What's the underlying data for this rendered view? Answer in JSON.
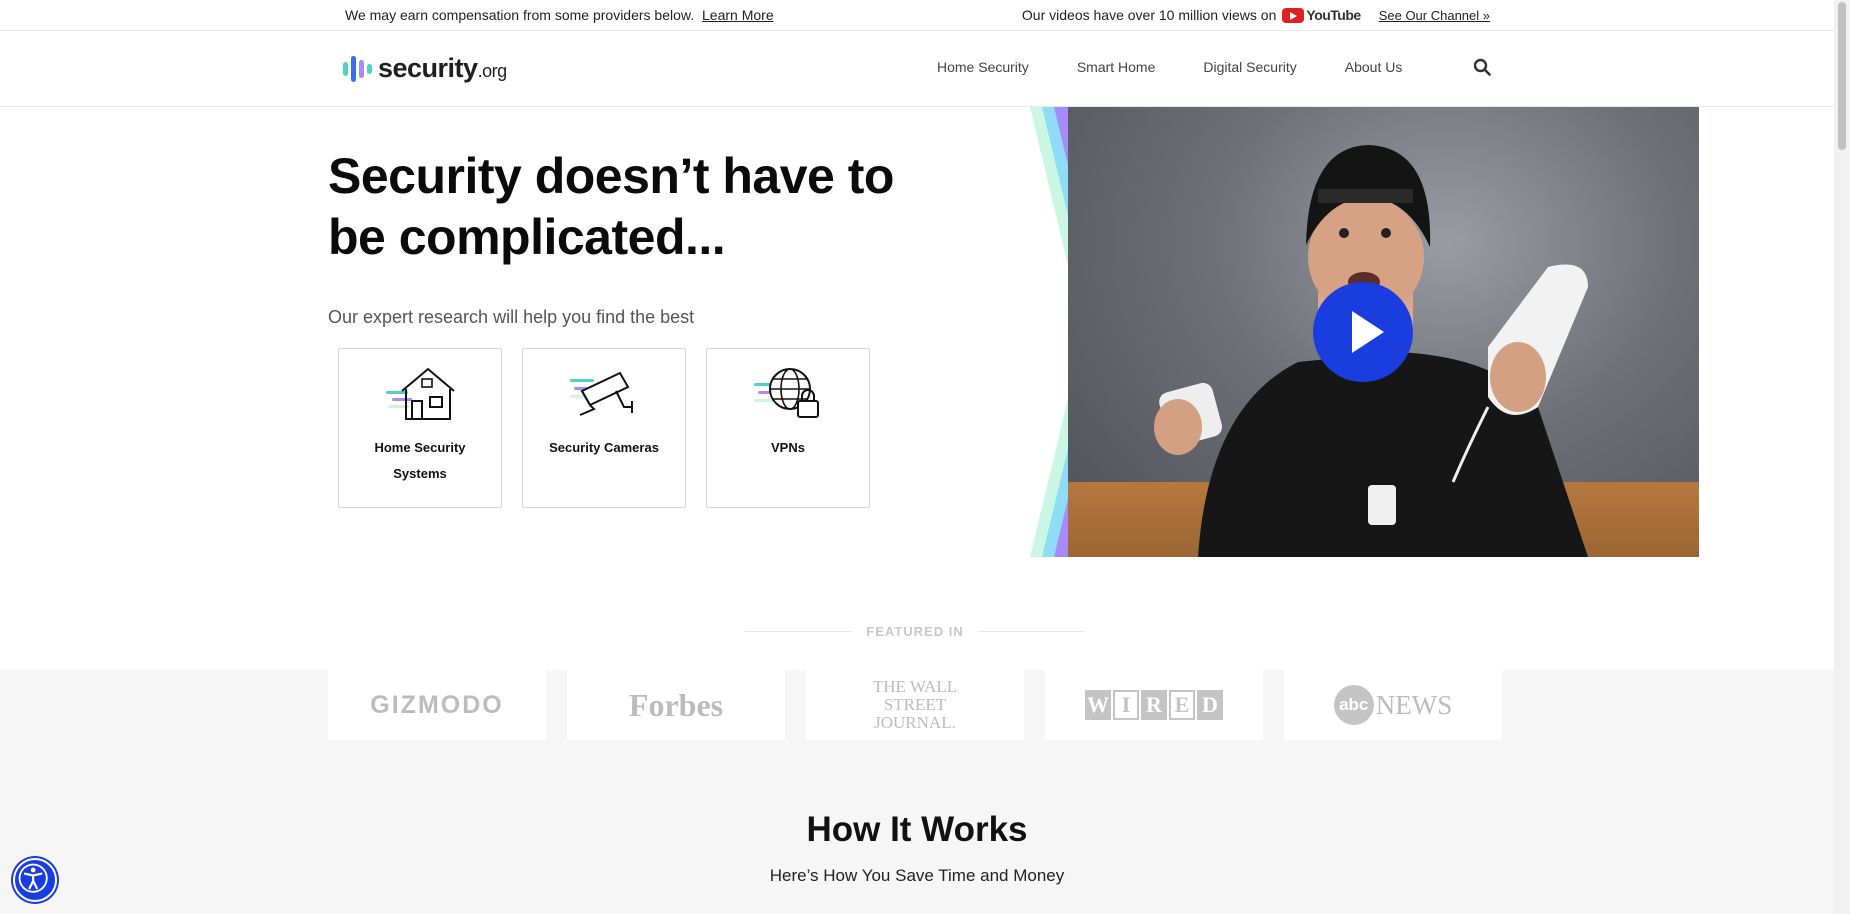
{
  "topbar": {
    "disclosure": "We may earn compensation from some providers below.",
    "learn_more": "Learn More",
    "views_text": "Our videos have over 10 million views on",
    "youtube_word": "YouTube",
    "channel_link": "See Our Channel »"
  },
  "header": {
    "logo_main": "security",
    "logo_suffix": ".org",
    "nav": [
      "Home Security",
      "Smart Home",
      "Digital Security",
      "About Us"
    ],
    "search_icon": "search-icon"
  },
  "hero": {
    "title": "Security doesn’t have to be complicated...",
    "subtitle": "Our expert research will help you find the best",
    "cards": [
      {
        "label": "Home Security Systems",
        "icon": "house-icon"
      },
      {
        "label": "Security Cameras",
        "icon": "security-camera-icon"
      },
      {
        "label": "VPNs",
        "icon": "globe-lock-icon"
      }
    ],
    "play_icon": "play-icon"
  },
  "featured": {
    "heading": "FEATURED IN",
    "logos": [
      "GIZMODO",
      "Forbes",
      "THE WALL STREET JOURNAL.",
      "WIRED",
      "abc NEWS"
    ]
  },
  "how": {
    "title": "How It Works",
    "subtitle": "Here’s How You Save Time and Money"
  },
  "colors": {
    "accent_blue": "#1a3de0",
    "teal": "#4fd1c5",
    "purple": "#a78bfa",
    "mint": "#c9f7e4"
  }
}
